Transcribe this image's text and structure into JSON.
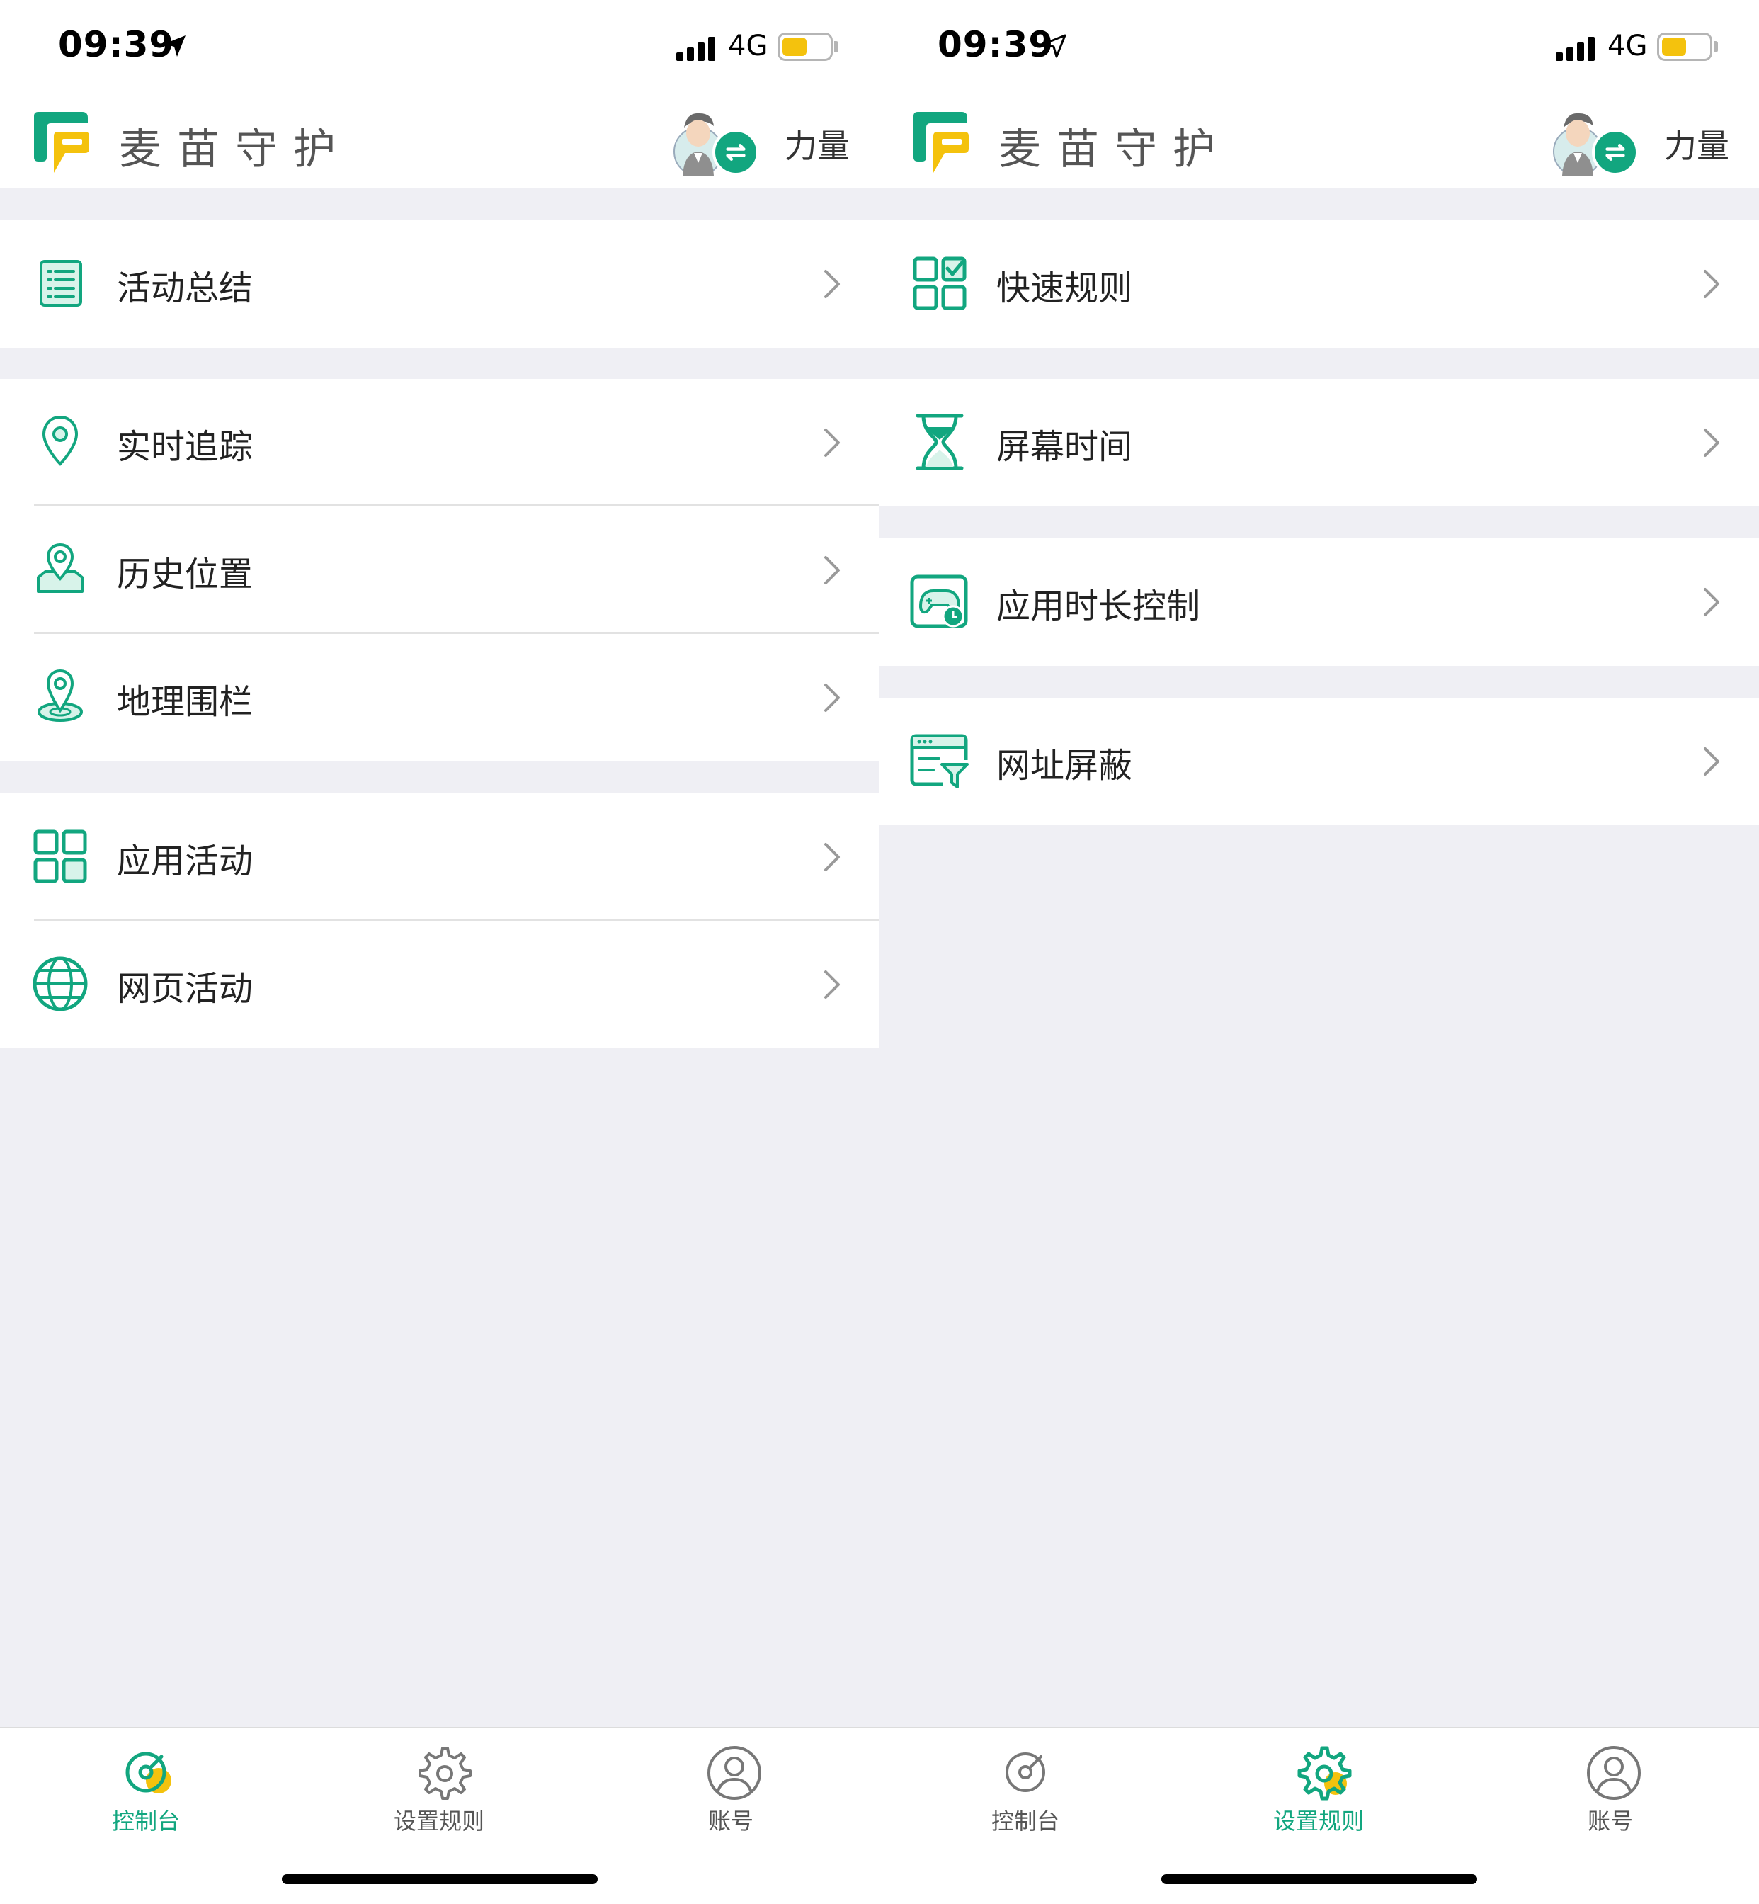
{
  "colors": {
    "accent": "#12a67f",
    "accent_yellow": "#f4c20d",
    "background": "#efeff4",
    "text": "#222222"
  },
  "status_bar": {
    "time": "09:39",
    "network": "4G"
  },
  "app": {
    "name": "麦苗守护",
    "user_name": "力量"
  },
  "screens": {
    "left": {
      "items": [
        {
          "label": "活动总结",
          "icon": "list-icon"
        },
        {
          "label": "实时追踪",
          "icon": "location-pin-icon"
        },
        {
          "label": "历史位置",
          "icon": "history-location-icon"
        },
        {
          "label": "地理围栏",
          "icon": "geofence-icon"
        },
        {
          "label": "应用活动",
          "icon": "apps-grid-icon"
        },
        {
          "label": "网页活动",
          "icon": "globe-icon"
        }
      ]
    },
    "right": {
      "items": [
        {
          "label": "快速规则",
          "icon": "quick-rules-icon"
        },
        {
          "label": "屏幕时间",
          "icon": "hourglass-icon"
        },
        {
          "label": "应用时长控制",
          "icon": "gamepad-clock-icon"
        },
        {
          "label": "网址屏蔽",
          "icon": "url-filter-icon"
        }
      ]
    }
  },
  "tab_bar": {
    "tabs": [
      {
        "label": "控制台",
        "icon": "dashboard-icon"
      },
      {
        "label": "设置规则",
        "icon": "gear-icon"
      },
      {
        "label": "账号",
        "icon": "account-icon"
      }
    ],
    "active_left": "控制台",
    "active_right": "设置规则"
  }
}
